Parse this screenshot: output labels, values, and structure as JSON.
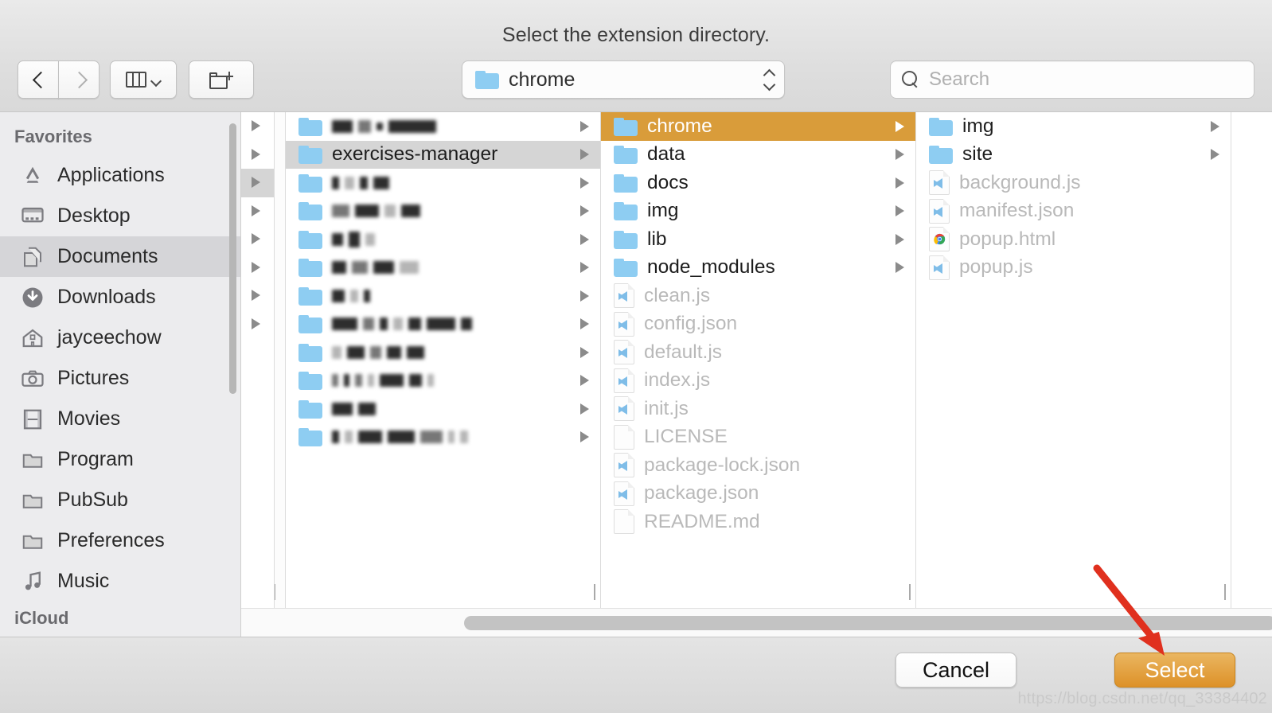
{
  "dialog": {
    "title": "Select the extension directory.",
    "watermark": "https://blog.csdn.net/qq_33384402"
  },
  "toolbar": {
    "back_icon": "chevron-left-icon",
    "forward_icon": "chevron-right-icon",
    "viewmode_icon": "column-view-icon",
    "viewmode_chevron_icon": "chevron-down-icon",
    "newfolder_icon": "new-folder-icon",
    "path_popup": {
      "value": "chrome",
      "folder_icon": "folder-icon",
      "stepper_icon": "stepper-updown-icon"
    },
    "search": {
      "placeholder": "Search",
      "icon": "search-icon",
      "value": ""
    }
  },
  "sidebar": {
    "sections": [
      {
        "header": "Favorites",
        "items": [
          {
            "label": "Applications",
            "icon": "applications-icon",
            "selected": false
          },
          {
            "label": "Desktop",
            "icon": "desktop-icon",
            "selected": false
          },
          {
            "label": "Documents",
            "icon": "documents-icon",
            "selected": true
          },
          {
            "label": "Downloads",
            "icon": "downloads-icon",
            "selected": false
          },
          {
            "label": "jayceechow",
            "icon": "home-icon",
            "selected": false
          },
          {
            "label": "Pictures",
            "icon": "pictures-icon",
            "selected": false
          },
          {
            "label": "Movies",
            "icon": "movies-icon",
            "selected": false
          },
          {
            "label": "Program",
            "icon": "folder-icon",
            "selected": false
          },
          {
            "label": "PubSub",
            "icon": "folder-icon",
            "selected": false
          },
          {
            "label": "Preferences",
            "icon": "folder-icon",
            "selected": false
          },
          {
            "label": "Music",
            "icon": "music-icon",
            "selected": false
          }
        ]
      },
      {
        "header": "iCloud",
        "items": []
      }
    ]
  },
  "browser": {
    "arrow_column": [
      {
        "selected": false
      },
      {
        "selected": false
      },
      {
        "selected": true
      },
      {
        "selected": false
      },
      {
        "selected": false
      },
      {
        "selected": false
      },
      {
        "selected": false
      },
      {
        "selected": false
      }
    ],
    "column_1": {
      "items": [
        {
          "label": "",
          "kind": "folder",
          "redacted": true,
          "selected": false,
          "disclosure": true
        },
        {
          "label": "exercises-manager",
          "kind": "folder",
          "redacted": false,
          "selected": true,
          "disclosure": true
        },
        {
          "label": "",
          "kind": "folder",
          "redacted": true,
          "selected": false,
          "disclosure": true
        },
        {
          "label": "",
          "kind": "folder",
          "redacted": true,
          "selected": false,
          "disclosure": true
        },
        {
          "label": "",
          "kind": "folder",
          "redacted": true,
          "selected": false,
          "disclosure": true
        },
        {
          "label": "",
          "kind": "folder",
          "redacted": true,
          "selected": false,
          "disclosure": true
        },
        {
          "label": "",
          "kind": "folder",
          "redacted": true,
          "selected": false,
          "disclosure": true
        },
        {
          "label": "",
          "kind": "folder",
          "redacted": true,
          "selected": false,
          "disclosure": true
        },
        {
          "label": "",
          "kind": "folder",
          "redacted": true,
          "selected": false,
          "disclosure": true
        },
        {
          "label": "",
          "kind": "folder",
          "redacted": true,
          "selected": false,
          "disclosure": true
        },
        {
          "label": "",
          "kind": "folder",
          "redacted": true,
          "selected": false,
          "disclosure": true
        },
        {
          "label": "",
          "kind": "folder",
          "redacted": true,
          "selected": false,
          "disclosure": true
        }
      ]
    },
    "column_2": {
      "items": [
        {
          "label": "chrome",
          "kind": "folder",
          "selected": true,
          "disclosure": true,
          "dim": false
        },
        {
          "label": "data",
          "kind": "folder",
          "selected": false,
          "disclosure": true,
          "dim": false
        },
        {
          "label": "docs",
          "kind": "folder",
          "selected": false,
          "disclosure": true,
          "dim": false
        },
        {
          "label": "img",
          "kind": "folder",
          "selected": false,
          "disclosure": true,
          "dim": false
        },
        {
          "label": "lib",
          "kind": "folder",
          "selected": false,
          "disclosure": true,
          "dim": false
        },
        {
          "label": "node_modules",
          "kind": "folder",
          "selected": false,
          "disclosure": true,
          "dim": false
        },
        {
          "label": "clean.js",
          "kind": "code",
          "selected": false,
          "disclosure": false,
          "dim": true
        },
        {
          "label": "config.json",
          "kind": "code",
          "selected": false,
          "disclosure": false,
          "dim": true
        },
        {
          "label": "default.js",
          "kind": "code",
          "selected": false,
          "disclosure": false,
          "dim": true
        },
        {
          "label": "index.js",
          "kind": "code",
          "selected": false,
          "disclosure": false,
          "dim": true
        },
        {
          "label": "init.js",
          "kind": "code",
          "selected": false,
          "disclosure": false,
          "dim": true
        },
        {
          "label": "LICENSE",
          "kind": "plain",
          "selected": false,
          "disclosure": false,
          "dim": true
        },
        {
          "label": "package-lock.json",
          "kind": "code",
          "selected": false,
          "disclosure": false,
          "dim": true
        },
        {
          "label": "package.json",
          "kind": "code",
          "selected": false,
          "disclosure": false,
          "dim": true
        },
        {
          "label": "README.md",
          "kind": "plain",
          "selected": false,
          "disclosure": false,
          "dim": true
        }
      ]
    },
    "column_3": {
      "items": [
        {
          "label": "img",
          "kind": "folder",
          "selected": false,
          "disclosure": true,
          "dim": false
        },
        {
          "label": "site",
          "kind": "folder",
          "selected": false,
          "disclosure": true,
          "dim": false
        },
        {
          "label": "background.js",
          "kind": "code",
          "selected": false,
          "disclosure": false,
          "dim": true
        },
        {
          "label": "manifest.json",
          "kind": "code",
          "selected": false,
          "disclosure": false,
          "dim": true
        },
        {
          "label": "popup.html",
          "kind": "chrome",
          "selected": false,
          "disclosure": false,
          "dim": true
        },
        {
          "label": "popup.js",
          "kind": "code",
          "selected": false,
          "disclosure": false,
          "dim": true
        }
      ]
    }
  },
  "footer": {
    "cancel_label": "Cancel",
    "select_label": "Select"
  },
  "annotation": {
    "arrow_color": "#e0301e",
    "points_at": "select-button"
  }
}
